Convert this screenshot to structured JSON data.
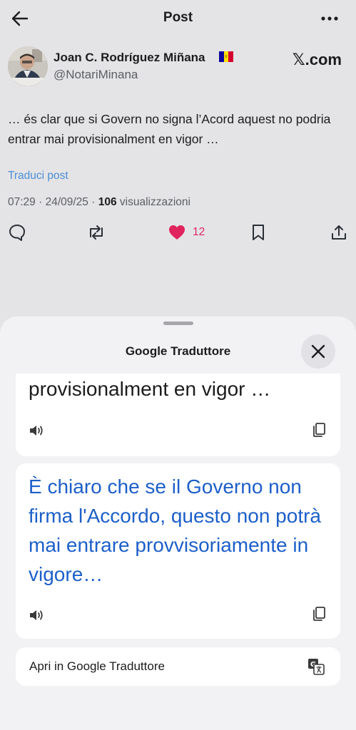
{
  "header": {
    "title": "Post",
    "back_icon": "arrow-left-icon",
    "more_icon": "more-horizontal-icon"
  },
  "post": {
    "author_name": "Joan C. Rodríguez Miñana",
    "author_flag": "andorra-flag",
    "author_handle": "@NotariMinana",
    "source_badge": "𝕏.com",
    "text": "… és clar que si Govern no signa l’Acord aquest no podria entrar mai provisionalment en vigor …",
    "translate_label": "Traduci post",
    "time": "07:29",
    "date": "24/09/25",
    "views_count": "106",
    "views_label": "visualizzazioni",
    "like_count": "12"
  },
  "sheet": {
    "title": "Google Traduttore",
    "source_text_visible": "provisionalment en vigor …",
    "translation": "È chiaro che se il Governo non firma l'Accordo, questo non potrà mai entrare provvisoriamente in vigore…",
    "open_label": "Apri in Google Traduttore"
  },
  "colors": {
    "background": "#e4e4e6",
    "sheet": "#f2f2f4",
    "link": "#4b8dd6",
    "translation": "#1d5fc9",
    "like": "#e0245e"
  }
}
